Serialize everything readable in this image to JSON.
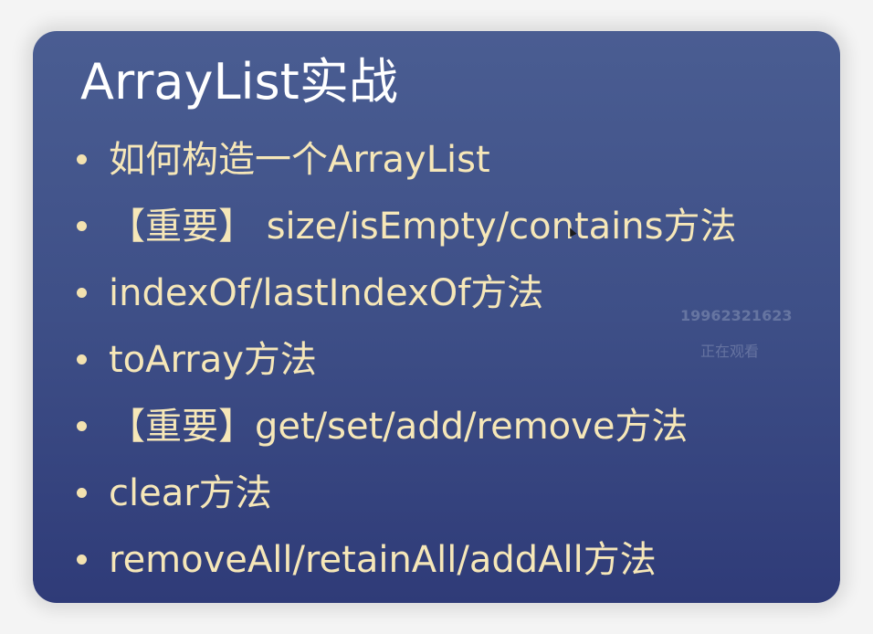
{
  "slide": {
    "title": "ArrayList实战",
    "bullets": [
      "如何构造一个ArrayList",
      "【重要】 size/isEmpty/contains方法",
      "indexOf/lastIndexOf方法",
      "toArray方法",
      "【重要】get/set/add/remove方法",
      "clear方法",
      "removeAll/retainAll/addAll方法"
    ]
  },
  "watermark": {
    "user_id": "19962321623",
    "status": "正在观看"
  },
  "colors": {
    "background_top": "#4a5d92",
    "background_bottom": "#2f3b78",
    "title_text": "#ffffff",
    "bullet_text": "#f6e7b8"
  },
  "icons": {
    "cursor": "mouse-cursor-icon"
  }
}
